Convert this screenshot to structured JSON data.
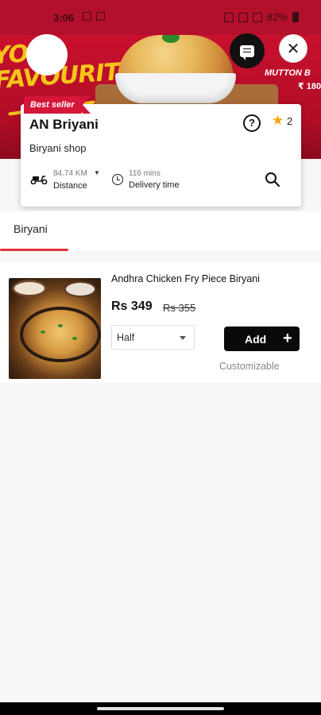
{
  "status_bar": {
    "time": "3:06",
    "battery": "82%"
  },
  "banner": {
    "promo_left": "YOUR FAVOURITE",
    "promo_right_title": "MUTTON B",
    "promo_right_price": "₹ 180"
  },
  "restaurant": {
    "badge": "Best seller",
    "name": "AN Briyani",
    "subtitle": "Biryani shop",
    "help_glyph": "?",
    "star_glyph": "★",
    "rating": "2",
    "distance_value": "84.74 KM",
    "distance_label": "Distance",
    "delivery_value": "116 mins",
    "delivery_label": "Delivery time"
  },
  "tabs": [
    {
      "label": "Biryani",
      "active": true
    }
  ],
  "menu": {
    "items": [
      {
        "name": "Andhra Chicken Fry Piece Biryani",
        "price": "Rs 349",
        "mrp": "Rs 355",
        "portion": "Half",
        "add_label": "Add",
        "add_plus": "+",
        "customizable": "Customizable"
      }
    ]
  },
  "icons": {
    "chat": "chat-icon",
    "close": "close-icon",
    "close_glyph": "✕",
    "search": "search-icon",
    "scooter": "scooter-icon",
    "clock": "clock-icon"
  },
  "colors": {
    "brand_red": "#c8102e",
    "accent_red": "#e2323a",
    "star": "#f5a400",
    "button_black": "#0a0a0a"
  }
}
